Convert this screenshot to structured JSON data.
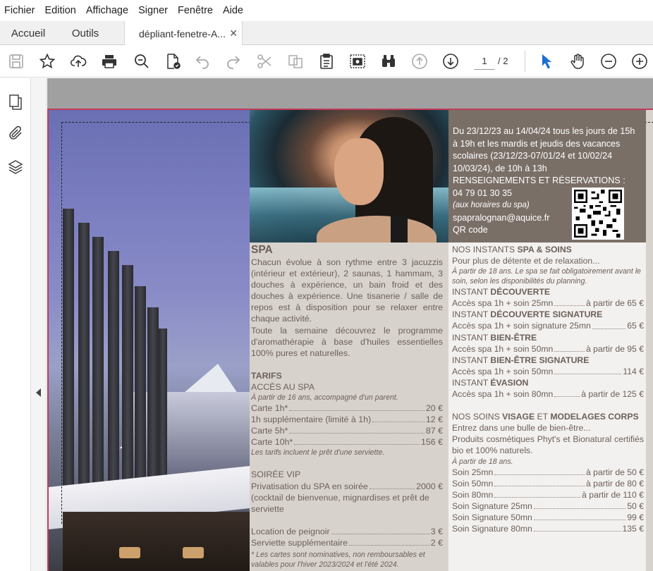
{
  "menu": [
    "Fichier",
    "Edition",
    "Affichage",
    "Signer",
    "Fenêtre",
    "Aide"
  ],
  "tabs": {
    "home": "Accueil",
    "tools": "Outils",
    "document": "dépliant-fenetre-A..."
  },
  "toolbar": {
    "page_current": "1",
    "page_total": "/ 2"
  },
  "brown_box": {
    "line1": "Du 23/12/23 au 14/04/24 tous les jours de 15h",
    "line2": "à 19h et les mardis et jeudis des vacances",
    "line3": "scolaires (23/12/23-07/01/24 et 10/02/24",
    "line4": "10/03/24), de 10h à 13h",
    "line5": "RENSEIGNEMENTS ET RÉSERVATIONS :",
    "phone": "04 79 01 30 35",
    "hours_note": "(aux horaires du spa)",
    "email": "spapralognan@aquice.fr",
    "qr_label": "QR code"
  },
  "spa": {
    "title": "SPA",
    "p1": "Chacun évolue à son rythme entre 3 jacuzzis (intérieur et extérieur), 2 saunas, 1 hammam, 3 douches à expérience, un bain froid et des douches à expérience. Une tisanerie / salle de repos est à disposition pour se relaxer entre chaque activité.",
    "p2": "Toute la semaine découvrez le programme d'aromathérapie à base d'huiles essentielles 100% pures et naturelles.",
    "tarifs_title": "TARIFS",
    "acces_title": "ACCÈS AU SPA",
    "acces_note": "À partir de 16 ans, accompagné d'un parent.",
    "prices": [
      {
        "label": "Carte 1h*",
        "price": "20 €"
      },
      {
        "label": "1h supplémentaire (limité à 1h)",
        "price": "12 €"
      },
      {
        "label": "Carte 5h*",
        "price": "87 €"
      },
      {
        "label": "Carte 10h*",
        "price": "156 €"
      }
    ],
    "towel_note": "Les tarifs incluent le prêt d'une serviette.",
    "soiree_title": "SOIRÉE VIP",
    "soiree_label": "Privatisation du SPA en soirée",
    "soiree_price": "2000 €",
    "soiree_desc": "(cocktail de bienvenue, mignardises et prêt de serviette",
    "extras": [
      {
        "label": "Location de peignoir",
        "price": "3 €"
      },
      {
        "label": "Serviette supplémentaire",
        "price": "2 €"
      }
    ],
    "footnote": "* Les cartes sont nominatives, non remboursables et valables pour l'hiver 2023/2024 et l'été 2024."
  },
  "instants": {
    "title_prefix": "NOS INSTANTS ",
    "title_bold": "SPA & SOINS",
    "intro": "Pour plus de détente et de relaxation...",
    "note": "À partir de 18 ans. Le spa se fait obligatoirement avant le soin, selon les disponibilités du planning.",
    "items": [
      {
        "prefix": "INSTANT ",
        "name": "DÉCOUVERTE",
        "label": "Accès spa 1h + soin 25mn",
        "price": "à partir de 65 €"
      },
      {
        "prefix": "INSTANT ",
        "name": "DÉCOUVERTE SIGNATURE",
        "label": "Accès spa 1h + soin signature 25mn",
        "price": "65 €"
      },
      {
        "prefix": "INSTANT ",
        "name": "BIEN-ÊTRE",
        "label": "Accès spa 1h + soin 50mn",
        "price": "à partir de 95 €"
      },
      {
        "prefix": "INSTANT ",
        "name": "BIEN-ÊTRE SIGNATURE",
        "label": "Accès spa 1h + soin 50mn",
        "price": "114 €"
      },
      {
        "prefix": "INSTANT ",
        "name": "ÉVASION",
        "label": "Accès spa 1h + soin 80mn",
        "price": "à partir de 125 €"
      }
    ]
  },
  "soins": {
    "title_prefix": "NOS SOINS ",
    "title_b1": "VISAGE",
    "title_mid": " ET ",
    "title_b2": "MODELAGES CORPS",
    "intro": "Entrez dans une bulle de bien-être...",
    "desc": "Produits cosmétiques Phyt's et Bionatural certifiés bio et 100% naturels.",
    "note": "À partir de 18 ans.",
    "items": [
      {
        "label": "Soin 25mn",
        "price": "à partir de 50 €"
      },
      {
        "label": "Soin 50mn",
        "price": "à partir de 80 €"
      },
      {
        "label": "Soin 80mn",
        "price": "à partir de 110 €"
      },
      {
        "label": "Soin Signature 25mn",
        "price": "50 €"
      },
      {
        "label": "Soin Signature 50mn",
        "price": "99 €"
      },
      {
        "label": "Soin Signature 80mn",
        "price": "135 €"
      }
    ]
  }
}
